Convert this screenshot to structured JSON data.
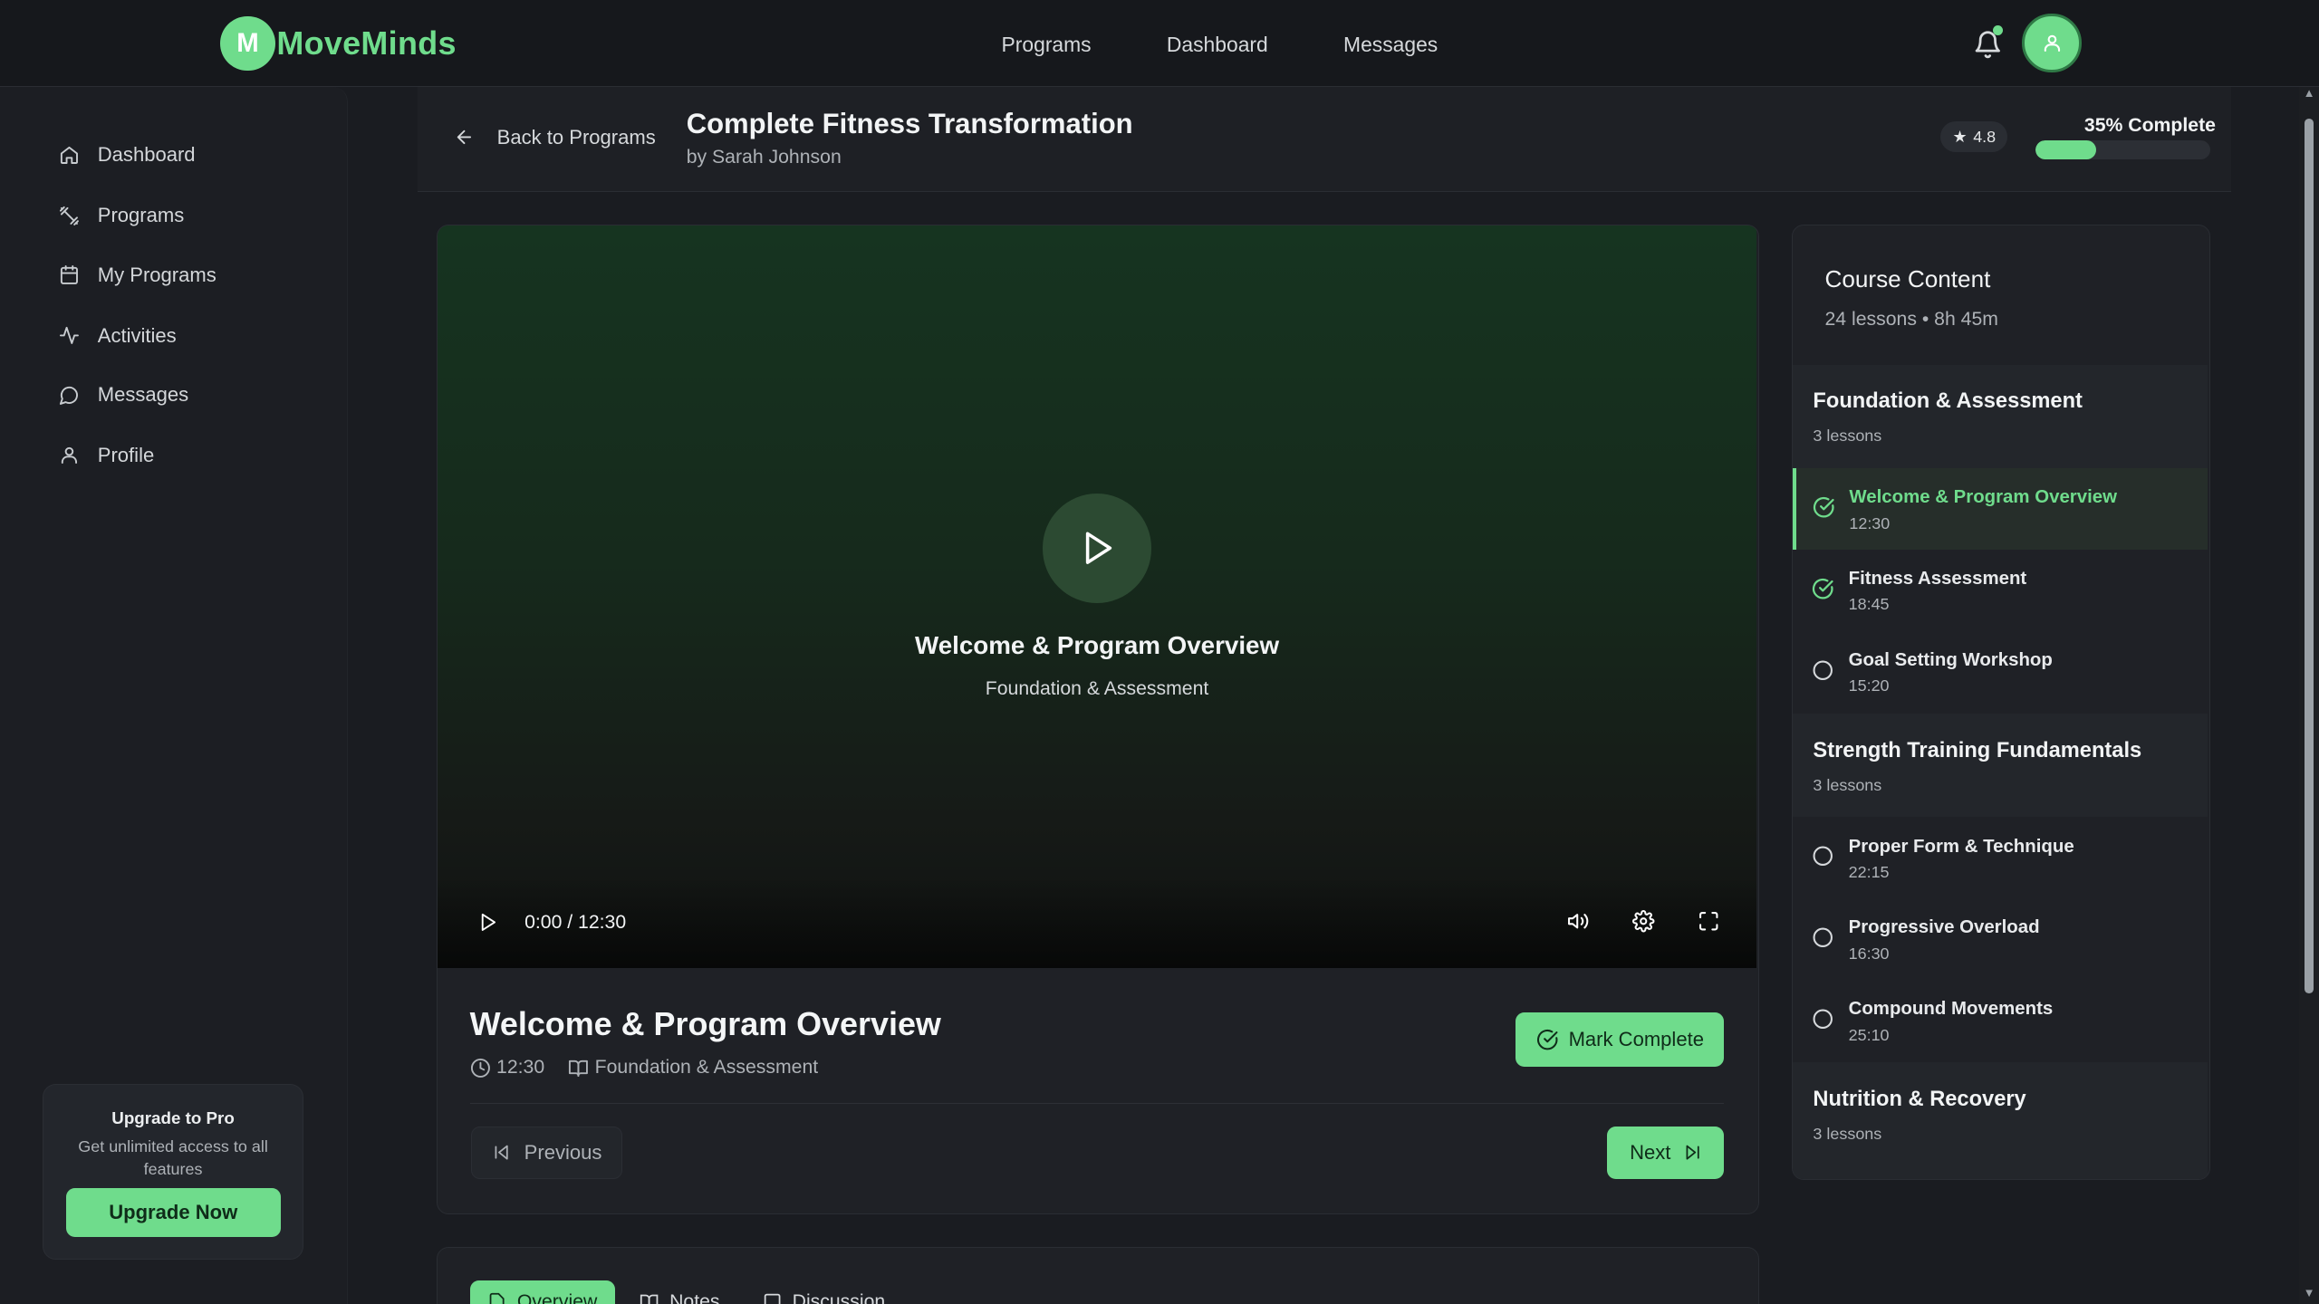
{
  "brand": {
    "logo_letter": "M",
    "name": "MoveMinds",
    "accent": "#6fdc8c"
  },
  "topnav": {
    "links": [
      "Programs",
      "Dashboard",
      "Messages"
    ]
  },
  "sidebar": {
    "items": [
      {
        "label": "Dashboard",
        "icon": "home-icon"
      },
      {
        "label": "Programs",
        "icon": "dumbbell-icon"
      },
      {
        "label": "My Programs",
        "icon": "calendar-icon"
      },
      {
        "label": "Activities",
        "icon": "activity-icon"
      },
      {
        "label": "Messages",
        "icon": "message-icon"
      },
      {
        "label": "Profile",
        "icon": "user-icon"
      }
    ],
    "upgrade": {
      "title": "Upgrade to Pro",
      "description": "Get unlimited access to all features",
      "button": "Upgrade Now"
    }
  },
  "course": {
    "back_label": "Back to Programs",
    "title": "Complete Fitness Transformation",
    "author": "by Sarah Johnson",
    "rating": "4.8",
    "progress_label": "35% Complete",
    "progress_fraction": 0.35
  },
  "player": {
    "title": "Welcome & Program Overview",
    "section": "Foundation & Assessment",
    "time": "0:00 / 12:30"
  },
  "lesson": {
    "title": "Welcome & Program Overview",
    "duration": "12:30",
    "section": "Foundation & Assessment",
    "mark_complete": "Mark Complete",
    "previous": "Previous",
    "next": "Next"
  },
  "tabs": [
    "Overview",
    "Notes",
    "Discussion"
  ],
  "course_content": {
    "title": "Course Content",
    "summary": "24 lessons • 8h 45m",
    "sections": [
      {
        "title": "Foundation & Assessment",
        "count": "3 lessons",
        "lessons": [
          {
            "name": "Welcome & Program Overview",
            "duration": "12:30",
            "done": true,
            "active": true
          },
          {
            "name": "Fitness Assessment",
            "duration": "18:45",
            "done": true,
            "active": false
          },
          {
            "name": "Goal Setting Workshop",
            "duration": "15:20",
            "done": false,
            "active": false
          }
        ]
      },
      {
        "title": "Strength Training Fundamentals",
        "count": "3 lessons",
        "lessons": [
          {
            "name": "Proper Form & Technique",
            "duration": "22:15",
            "done": false,
            "active": false
          },
          {
            "name": "Progressive Overload",
            "duration": "16:30",
            "done": false,
            "active": false
          },
          {
            "name": "Compound Movements",
            "duration": "25:10",
            "done": false,
            "active": false
          }
        ]
      },
      {
        "title": "Nutrition & Recovery",
        "count": "3 lessons",
        "lessons": []
      }
    ]
  }
}
